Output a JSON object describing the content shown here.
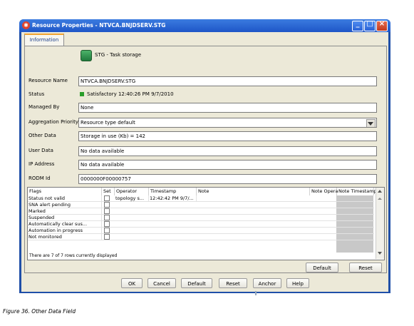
{
  "window": {
    "title": "Resource Properties - NTVCA.BNJDSERV.STG"
  },
  "tabs": [
    {
      "label": "Information"
    }
  ],
  "resource": {
    "header": "STG - Task storage"
  },
  "fields": {
    "resource_name": {
      "label": "Resource Name",
      "value": "NTVCA.BNJDSERV.STG"
    },
    "status": {
      "label": "Status",
      "value": "Satisfactory 12:40:26 PM 9/7/2010",
      "color": "#2a9d2a"
    },
    "managed_by": {
      "label": "Managed By",
      "value": "None"
    },
    "aggregation_priority": {
      "label": "Aggregation Priority",
      "value": "Resource type default"
    },
    "other_data": {
      "label": "Other Data",
      "value": "Storage in use (Kb) = 142"
    },
    "user_data": {
      "label": "User Data",
      "value": "No data available"
    },
    "ip_address": {
      "label": "IP Address",
      "value": "No data available"
    },
    "rodm_id": {
      "label": "RODM Id",
      "value": "0000000F00000757"
    }
  },
  "table": {
    "columns": [
      "Flags",
      "Set",
      "Operator",
      "Timestamp",
      "Note",
      "Note Opera",
      "Note Timestamp"
    ],
    "rows": [
      {
        "flag": "Status not valid",
        "operator": "topology s...",
        "timestamp": "12:42:42 PM 9/7/..."
      },
      {
        "flag": "SNA alert pending",
        "operator": "",
        "timestamp": ""
      },
      {
        "flag": "Marked",
        "operator": "",
        "timestamp": ""
      },
      {
        "flag": "Suspended",
        "operator": "",
        "timestamp": ""
      },
      {
        "flag": "Automatically clear sus...",
        "operator": "",
        "timestamp": ""
      },
      {
        "flag": "Automation in progress",
        "operator": "",
        "timestamp": ""
      },
      {
        "flag": "Not monitored",
        "operator": "",
        "timestamp": ""
      }
    ],
    "footer": "There are 7 of 7 rows currently displayed"
  },
  "panel_buttons": {
    "default": "Default",
    "reset": "Reset"
  },
  "bottom_buttons": {
    "ok": "OK",
    "cancel": "Cancel",
    "default": "Default",
    "reset": "Reset",
    "anchor": "Anchor",
    "help": "Help"
  },
  "caption": "Figure 36. Other Data Field"
}
